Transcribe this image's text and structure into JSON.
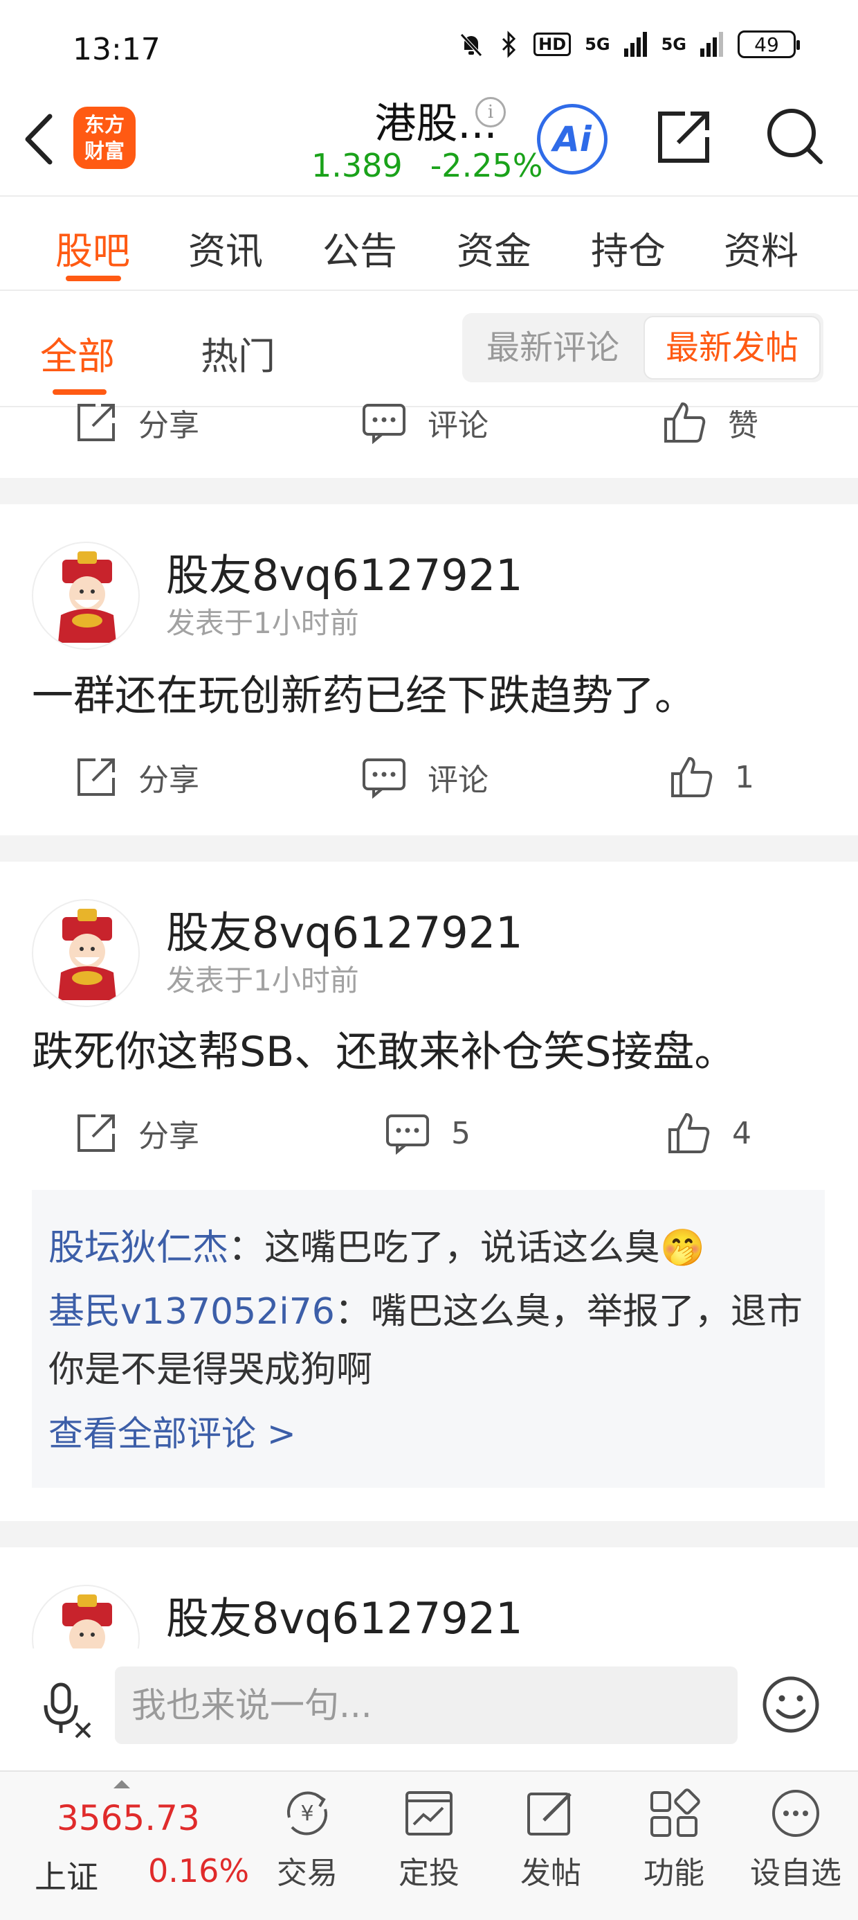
{
  "status_bar": {
    "time": "13:17",
    "battery": "49",
    "network_1": "5G",
    "network_2": "5G",
    "hd_label": "HD"
  },
  "header": {
    "logo_line1": "东方",
    "logo_line2": "财富",
    "title": "港股...",
    "info_symbol": "i",
    "price": "1.389",
    "change_pct": "-2.25%",
    "ai_label": "Ai"
  },
  "main_tabs": [
    "股吧",
    "资讯",
    "公告",
    "资金",
    "持仓",
    "资料"
  ],
  "sub_tabs": {
    "all": "全部",
    "hot": "热门",
    "sort_latest_comment": "最新评论",
    "sort_latest_post": "最新发帖"
  },
  "actions": {
    "share": "分享",
    "comment": "评论",
    "like": "赞"
  },
  "posts": [
    {
      "username": "股友8vq6127921",
      "time": "发表于1小时前",
      "text": "一群还在玩创新药已经下跌趋势了。",
      "comment_label": "评论",
      "like_count": "1"
    },
    {
      "username": "股友8vq6127921",
      "time": "发表于1小时前",
      "text": "跌死你这帮SB、还敢来补仓笑S接盘。",
      "comment_count": "5",
      "like_count": "4"
    },
    {
      "username": "股友8vq6127921"
    }
  ],
  "comments": [
    {
      "user": "股坛狄仁杰",
      "text": "：这嘴巴吃了，说话这么臭🤭"
    },
    {
      "user": "基民v137052i76",
      "text": "：嘴巴这么臭，举报了，退市你是不是得哭成狗啊"
    }
  ],
  "view_all_comments": "查看全部评论 >",
  "input": {
    "placeholder": "我也来说一句..."
  },
  "bottom_nav": {
    "index_value": "3565.73",
    "index_name": "上证",
    "index_change": "0.16%",
    "items": [
      "交易",
      "定投",
      "发帖",
      "功能",
      "设自选"
    ]
  },
  "colors": {
    "accent": "#ff5a13",
    "up": "#e02b2b",
    "down": "#1aa21a",
    "link": "#3c5ea8",
    "ai": "#2f6be8"
  }
}
